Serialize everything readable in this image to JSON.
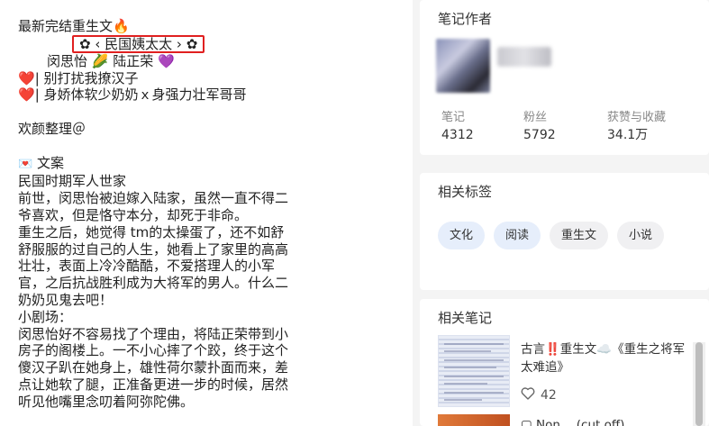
{
  "note": {
    "line1": "最新完结重生文",
    "line1_emoji": "🔥",
    "title_flower_left": "✿",
    "title_text": "‹ 民国姨太太 ›",
    "title_flower_right": "✿",
    "name1": "闵思怡",
    "name_corn": "🌽",
    "name2": "陆正荣",
    "name_heart": "💜",
    "tag_line1": "| 别打扰我撩汉子",
    "tag_line2": "| 身娇体软少奶奶ｘ身强力壮军哥哥",
    "heart": "❤️",
    "curator": "欢颜整理＠",
    "envelope": "💌",
    "section_label": "文案",
    "body_lines": [
      "民国时期军人世家",
      "前世，闵思怡被迫嫁入陆家，虽然一直不得二",
      "爷喜欢，但是恪守本分，却死于非命。",
      "重生之后，她觉得 tm的太操蛋了，还不如舒",
      "舒服服的过自己的人生，她看上了家里的高高",
      "壮壮，表面上冷冷酷酷，不爱搭理人的小军",
      "官，之后抗战胜利成为大将军的男人。什么二",
      "奶奶见鬼去吧！",
      "小剧场：",
      "闵思怡好不容易找了个理由，将陆正荣带到小",
      "房子的阁楼上。一不小心摔了个跤，终于这个",
      "傻汉子趴在她身上，雄性荷尔蒙扑面而来，差",
      "点让她软了腿，正准备更进一步的时候，居然",
      "听见他嘴里念叨着阿弥陀佛。"
    ]
  },
  "author_card": {
    "title": "笔记作者",
    "stats": [
      {
        "label": "笔记",
        "value": "4312"
      },
      {
        "label": "粉丝",
        "value": "5792"
      },
      {
        "label": "获赞与收藏",
        "value": "34.1万"
      }
    ]
  },
  "tags_card": {
    "title": "相关标签",
    "tags": [
      "文化",
      "阅读",
      "重生文",
      "小说"
    ]
  },
  "related_card": {
    "title": "相关笔记",
    "item1_title": "古言‼️重生文☁️《重生之将军太难追》",
    "item1_likes": "42",
    "item2_title": "▢ Non… (cut off)"
  },
  "icons": {
    "like": "heart-outline-icon"
  },
  "colors": {
    "title_box_border": "#e02020",
    "tag_blue_bg": "#e6eefb"
  }
}
